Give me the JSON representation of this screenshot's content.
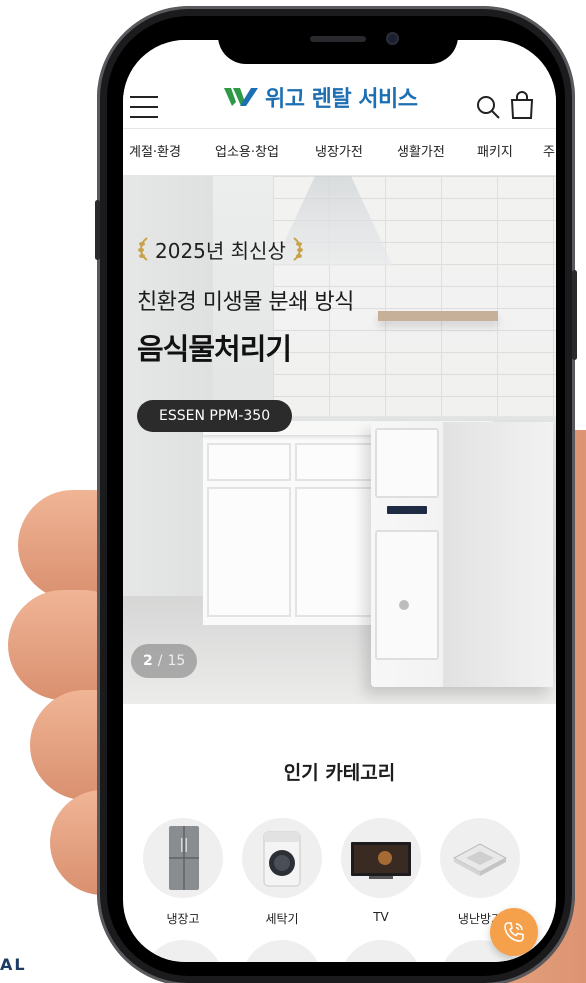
{
  "corner_brand": "AL",
  "header": {
    "logo_text": "위고 렌탈 서비스",
    "icons": {
      "menu": "hamburger-menu-icon",
      "search": "search-icon",
      "cart": "shopping-bag-icon"
    },
    "brand_color": "#1d6fb3",
    "logo_mark_colors": [
      "#2e9a46",
      "#1d6fb3"
    ]
  },
  "tabs": [
    {
      "label": "계절·환경",
      "active": false
    },
    {
      "label": "업소용·창업",
      "active": true
    },
    {
      "label": "냉장가전",
      "active": false
    },
    {
      "label": "생활가전",
      "active": false
    },
    {
      "label": "패키지",
      "active": false
    },
    {
      "label": "주",
      "active": false
    }
  ],
  "hero": {
    "badge": "2025년 최신상",
    "subtitle": "친환경 미생물 분쇄 방식",
    "title": "음식물처리기",
    "model": "ESSEN PPM-350",
    "slide_current": "2",
    "slide_separator": "/",
    "slide_total": "15"
  },
  "popular": {
    "title": "인기 카테고리",
    "items": [
      {
        "label": "냉장고",
        "icon": "refrigerator-icon"
      },
      {
        "label": "세탁기",
        "icon": "washing-machine-icon"
      },
      {
        "label": "TV",
        "icon": "tv-icon"
      },
      {
        "label": "냉난방기",
        "icon": "ceiling-air-conditioner-icon"
      }
    ]
  },
  "fab": {
    "icon": "phone-call-icon",
    "color": "#f5a04a"
  }
}
